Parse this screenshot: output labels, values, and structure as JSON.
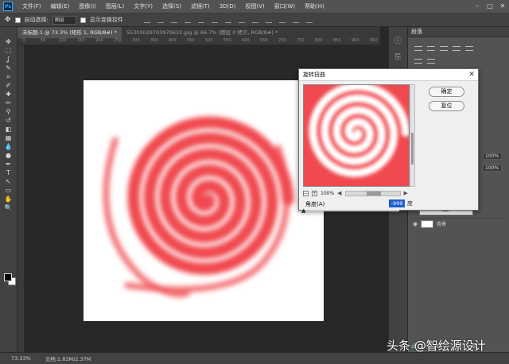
{
  "app": {
    "logo_text": "Ps"
  },
  "menubar": {
    "items": [
      "文件(F)",
      "编辑(E)",
      "图像(I)",
      "图层(L)",
      "文字(Y)",
      "选择(S)",
      "滤镜(T)",
      "3D(D)",
      "视图(V)",
      "窗口(W)",
      "帮助(H)"
    ]
  },
  "window_controls": {
    "minimize": "–",
    "maximize": "□",
    "close": "✕"
  },
  "options_bar": {
    "auto_select_label": "自动选择:",
    "auto_select_value": "图层",
    "show_transform_label": "显示变换控件"
  },
  "tabs": [
    {
      "label": "未标题-1 @ 73.3% (矩形 1, RGB/8#) *",
      "active": true
    },
    {
      "label": "55303029703970633.jpg @ 66.7% (图层 0 拷贝, RGB/8#) *",
      "active": false
    }
  ],
  "ruler_ticks": [
    "0",
    "50",
    "100",
    "150",
    "200",
    "250",
    "300",
    "350",
    "400",
    "450",
    "500",
    "550",
    "600",
    "650",
    "700",
    "750",
    "800",
    "850",
    "900",
    "950"
  ],
  "tools": [
    "move-tool",
    "marquee-tool",
    "lasso-tool",
    "quick-select-tool",
    "crop-tool",
    "eyedropper-tool",
    "healing-tool",
    "brush-tool",
    "stamp-tool",
    "history-brush-tool",
    "eraser-tool",
    "gradient-tool",
    "blur-tool",
    "dodge-tool",
    "pen-tool",
    "type-tool",
    "path-select-tool",
    "shape-tool",
    "hand-tool",
    "zoom-tool"
  ],
  "tool_glyphs": [
    "✥",
    "⬚",
    "ʆ",
    "✎",
    "⌗",
    "✐",
    "✚",
    "✏",
    "⚲",
    "↺",
    "◧",
    "▦",
    "💧",
    "●",
    "✒",
    "T",
    "↖",
    "▭",
    "✋",
    "🔍"
  ],
  "statusbar": {
    "zoom": "73.33%",
    "doc_info": "文档:1.83M/2.37M"
  },
  "right_panel": {
    "title": "段落",
    "percent_1": "100%",
    "percent_2": "100%",
    "layer_name": "背景",
    "footer_icons": [
      "🔗",
      "fx",
      "◐",
      "▭",
      "🗀",
      "🗑"
    ]
  },
  "icon_strip": {
    "glyphs": [
      "ⓘ",
      "⎘",
      "☰",
      "⬢",
      "⚙"
    ]
  },
  "dialog": {
    "title": "旋转扭曲",
    "close": "✕",
    "ok_label": "确定",
    "reset_label": "复位",
    "zoom_value": "100%",
    "zoom_minus": "−",
    "zoom_plus": "+",
    "angle_label": "角度(A)",
    "angle_value": "-999",
    "angle_unit": "度"
  },
  "watermark": "头条 @智绘源设计",
  "colors": {
    "swirl_red": "#f04a50",
    "swirl_light": "#ffd6d8"
  }
}
